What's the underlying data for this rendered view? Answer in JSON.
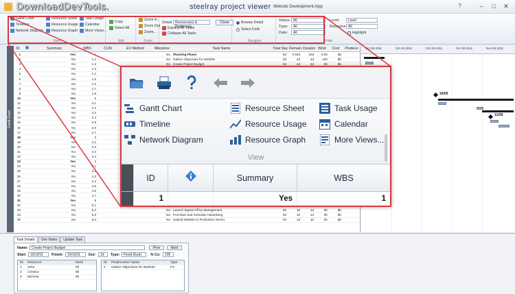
{
  "window": {
    "watermark": "DownloadDevTools.",
    "title": "steelray project viewer",
    "file_name": "Website Development.mpp",
    "help_glyph": "?",
    "minimize_glyph": "–",
    "maximize_glyph": "□",
    "close_glyph": "✕"
  },
  "ribbon": {
    "view_items": [
      "Gantt Chart",
      "Timeline",
      "Network Diagram",
      "Resource Sheet",
      "Resource Usage",
      "Resource Graph",
      "Task Usage",
      "Calendar",
      "More Views..."
    ],
    "view_group": "View",
    "edit_items": [
      "Copy",
      "Select All"
    ],
    "edit_group": "Edit",
    "zoom_items": [
      "Zoom In",
      "Zoom Out",
      "Zoom..."
    ],
    "zoom_group": "Zoom",
    "outline_items": [
      "Expand All Tasks",
      "Collapse All Tasks"
    ],
    "outline_detail": "Detail",
    "outline_detail_value": "Resource(s) & Predecess...",
    "close_label": "Close",
    "navigate_items": [
      "Browse Detail",
      "Select Cells"
    ],
    "navigate_group": "Navigate",
    "filter_labels": [
      "Status:",
      "Type:",
      "Date:"
    ],
    "filter_values": [
      "All",
      "All",
      "All"
    ],
    "level_label": "Level:",
    "level_value": "Level",
    "resource_label": "Resource:",
    "resource_value": "All",
    "highlight_label": "Highlight",
    "filter_group": "Filter"
  },
  "side_strip_label": "Gantt Chart",
  "grid": {
    "columns": [
      "ID",
      "",
      "Summary",
      "WBS",
      "CLIN",
      "EV Method",
      "Milestone",
      "Task Name",
      "Total Slack",
      "Remaining",
      "Duration",
      "Work",
      "Cost",
      "Predece"
    ],
    "rows": [
      {
        "id": "1",
        "summary": "Yes",
        "wbs": "1",
        "ms": "No",
        "name": "Planning Phase",
        "slack": "0d",
        "rem": "0.94d",
        "dur": "10d",
        "work": "8.00",
        "cost": "$0"
      },
      {
        "id": "2",
        "summary": "No",
        "wbs": "1.1",
        "ms": "No",
        "name": "Gather Objectives for Website",
        "slack": "0d",
        "rem": "4d",
        "dur": "4d",
        "work": "24h",
        "cost": "$0"
      },
      {
        "id": "3",
        "summary": "No",
        "wbs": "1.2",
        "ms": "No",
        "name": "Create Project Budget",
        "slack": "0d",
        "rem": "4d",
        "dur": "4d",
        "work": "8h",
        "cost": "$0"
      },
      {
        "id": "4",
        "summary": "No",
        "wbs": "1.3",
        "ms": "No",
        "name": "",
        "slack": "",
        "rem": "",
        "dur": "",
        "work": "",
        "cost": ""
      },
      {
        "id": "5",
        "summary": "No",
        "wbs": "1.4",
        "ms": "No",
        "name": "",
        "slack": "",
        "rem": "",
        "dur": "",
        "work": "",
        "cost": ""
      },
      {
        "id": "6",
        "summary": "No",
        "wbs": "1.5",
        "ms": "No",
        "name": "",
        "slack": "",
        "rem": "",
        "dur": "",
        "work": "",
        "cost": ""
      },
      {
        "id": "7",
        "summary": "No",
        "wbs": "1.6",
        "ms": "No",
        "name": "",
        "slack": "",
        "rem": "",
        "dur": "",
        "work": "",
        "cost": ""
      },
      {
        "id": "8",
        "summary": "No",
        "wbs": "1.7",
        "ms": "No",
        "name": "",
        "slack": "",
        "rem": "",
        "dur": "",
        "work": "",
        "cost": ""
      },
      {
        "id": "9",
        "summary": "No",
        "wbs": "1.8",
        "ms": "No",
        "name": "",
        "slack": "",
        "rem": "",
        "dur": "",
        "work": "",
        "cost": ""
      },
      {
        "id": "10",
        "summary": "Yes",
        "wbs": "2",
        "ms": "No",
        "name": "",
        "slack": "",
        "rem": "",
        "dur": "",
        "work": "",
        "cost": ""
      },
      {
        "id": "11",
        "summary": "No",
        "wbs": "2.1",
        "ms": "No",
        "name": "",
        "slack": "",
        "rem": "",
        "dur": "",
        "work": "",
        "cost": ""
      },
      {
        "id": "12",
        "summary": "No",
        "wbs": "2.2",
        "ms": "No",
        "name": "",
        "slack": "",
        "rem": "",
        "dur": "",
        "work": "",
        "cost": ""
      },
      {
        "id": "13",
        "summary": "No",
        "wbs": "2.3",
        "ms": "No",
        "name": "",
        "slack": "",
        "rem": "",
        "dur": "",
        "work": "",
        "cost": ""
      },
      {
        "id": "14",
        "summary": "No",
        "wbs": "2.4",
        "ms": "No",
        "name": "",
        "slack": "",
        "rem": "",
        "dur": "",
        "work": "",
        "cost": ""
      },
      {
        "id": "15",
        "summary": "No",
        "wbs": "2.5",
        "ms": "No",
        "name": "",
        "slack": "",
        "rem": "",
        "dur": "",
        "work": "",
        "cost": ""
      },
      {
        "id": "16",
        "summary": "No",
        "wbs": "2.6",
        "ms": "No",
        "name": "",
        "slack": "",
        "rem": "",
        "dur": "",
        "work": "",
        "cost": ""
      },
      {
        "id": "17",
        "summary": "No",
        "wbs": "2.7",
        "ms": "No",
        "name": "",
        "slack": "",
        "rem": "",
        "dur": "",
        "work": "",
        "cost": ""
      },
      {
        "id": "18",
        "summary": "Yes",
        "wbs": "3",
        "ms": "No",
        "name": "",
        "slack": "",
        "rem": "",
        "dur": "",
        "work": "",
        "cost": ""
      },
      {
        "id": "19",
        "summary": "No",
        "wbs": "3.1",
        "ms": "No",
        "name": "",
        "slack": "",
        "rem": "",
        "dur": "",
        "work": "",
        "cost": ""
      },
      {
        "id": "20",
        "summary": "No",
        "wbs": "3.2",
        "ms": "No",
        "name": "",
        "slack": "",
        "rem": "",
        "dur": "",
        "work": "",
        "cost": ""
      },
      {
        "id": "21",
        "summary": "No",
        "wbs": "3.3",
        "ms": "No",
        "name": "",
        "slack": "",
        "rem": "",
        "dur": "",
        "work": "",
        "cost": ""
      },
      {
        "id": "22",
        "summary": "No",
        "wbs": "3.4",
        "ms": "No",
        "name": "",
        "slack": "",
        "rem": "",
        "dur": "",
        "work": "",
        "cost": ""
      },
      {
        "id": "23",
        "summary": "Yes",
        "wbs": "4",
        "ms": "No",
        "name": "",
        "slack": "",
        "rem": "",
        "dur": "",
        "work": "",
        "cost": ""
      },
      {
        "id": "24",
        "summary": "No",
        "wbs": "4.1",
        "ms": "No",
        "name": "",
        "slack": "",
        "rem": "",
        "dur": "",
        "work": "",
        "cost": ""
      },
      {
        "id": "25",
        "summary": "No",
        "wbs": "4.2",
        "ms": "No",
        "name": "",
        "slack": "",
        "rem": "",
        "dur": "",
        "work": "",
        "cost": ""
      },
      {
        "id": "26",
        "summary": "No",
        "wbs": "4.3",
        "ms": "No",
        "name": "",
        "slack": "",
        "rem": "",
        "dur": "",
        "work": "",
        "cost": ""
      },
      {
        "id": "27",
        "summary": "No",
        "wbs": "4.4",
        "ms": "No",
        "name": "",
        "slack": "",
        "rem": "",
        "dur": "",
        "work": "",
        "cost": ""
      },
      {
        "id": "28",
        "summary": "No",
        "wbs": "4.5",
        "ms": "No",
        "name": "",
        "slack": "",
        "rem": "",
        "dur": "",
        "work": "",
        "cost": ""
      },
      {
        "id": "29",
        "summary": "No",
        "wbs": "4.6",
        "ms": "No",
        "name": "",
        "slack": "",
        "rem": "",
        "dur": "",
        "work": "",
        "cost": ""
      },
      {
        "id": "30",
        "summary": "No",
        "wbs": "4.7",
        "ms": "No",
        "name": "",
        "slack": "",
        "rem": "",
        "dur": "",
        "work": "",
        "cost": ""
      },
      {
        "id": "31",
        "summary": "Yes",
        "wbs": "5",
        "ms": "No",
        "name": "Launch",
        "slack": "0d",
        "rem": "4d",
        "dur": "4d",
        "work": "0h",
        "cost": "$0"
      },
      {
        "id": "32",
        "summary": "No",
        "wbs": "5.1",
        "ms": "No",
        "name": "Conduct Launch Review",
        "slack": "0d",
        "rem": "1d",
        "dur": "1d",
        "work": "16h",
        "cost": "$0"
      },
      {
        "id": "33",
        "summary": "No",
        "wbs": "5.2",
        "ms": "No",
        "name": "Launch Signed off by Management",
        "slack": "0d",
        "rem": "1d",
        "dur": "1d",
        "work": "8h",
        "cost": "$0"
      },
      {
        "id": "34",
        "summary": "No",
        "wbs": "5.3",
        "ms": "No",
        "name": "Purchase and Schedule Advertising",
        "slack": "0d",
        "rem": "1d",
        "dur": "1d",
        "work": "8h",
        "cost": "$0"
      },
      {
        "id": "35",
        "summary": "No",
        "wbs": "5.4",
        "ms": "No",
        "name": "Submit Website to Production Server",
        "slack": "0d",
        "rem": "1d",
        "dur": "1d",
        "work": "8h",
        "cost": "$0"
      }
    ]
  },
  "gantt": {
    "months": [
      "Oct 09 2011",
      "Oct 16 2011",
      "Oct 23 2011",
      "Oct 30 2011",
      "Nov 06 2011"
    ],
    "milestone_labels": [
      "10/05",
      "11/08"
    ]
  },
  "details": {
    "tabs": [
      "Task Details",
      "Dev Notes",
      "Update Task"
    ],
    "name_label": "Name:",
    "name_value": "Create Project Budget",
    "prev_label": "Prev",
    "next_label": "Next",
    "start_label": "Start:",
    "start_value": "10/10/11",
    "finish_label": "Finish:",
    "finish_value": "10/10/11",
    "dur_label": "Dur:",
    "dur_value": "1d",
    "type_label": "Type:",
    "type_value": "Fixed Durat",
    "pct_label": "% Co:",
    "pct_value": "100",
    "resources": {
      "headers": [
        "ID",
        "Resource",
        "Work"
      ],
      "rows": [
        [
          "1",
          "John",
          "8h"
        ],
        [
          "2",
          "Cristina",
          "8h"
        ],
        [
          "5",
          "Michele",
          "8h"
        ]
      ]
    },
    "predecessors": {
      "headers": [
        "ID",
        "Predecessor Name",
        "Type"
      ],
      "rows": [
        [
          "2",
          "Gather Objectives for Website",
          "FS"
        ]
      ]
    }
  },
  "zoom": {
    "view_items": [
      "Gantt Chart",
      "Timeline",
      "Network Diagram",
      "Resource Sheet",
      "Resource Usage",
      "Resource Graph",
      "Task Usage",
      "Calendar",
      "More Views..."
    ],
    "view_group": "View",
    "table_headers": [
      "ID",
      "",
      "Summary",
      "WBS"
    ],
    "table_row": {
      "id": "1",
      "summary": "Yes",
      "wbs": "1"
    }
  },
  "colors": {
    "highlight": "#d9363e",
    "accent": "#2e5d99"
  }
}
